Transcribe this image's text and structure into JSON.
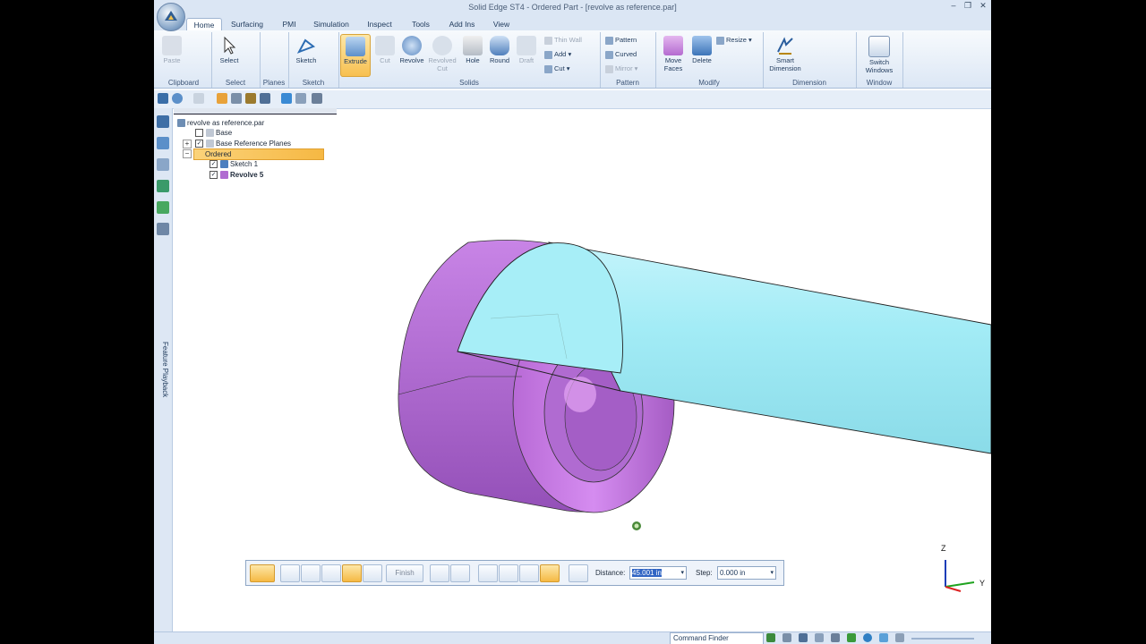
{
  "window": {
    "title": "Solid Edge ST4 - Ordered Part - [revolve as reference.par]",
    "minimize": "–",
    "restore": "❐",
    "close": "✕",
    "help": "?"
  },
  "tabs": [
    {
      "label": "Home"
    },
    {
      "label": "Surfacing"
    },
    {
      "label": "PMI"
    },
    {
      "label": "Simulation"
    },
    {
      "label": "Inspect"
    },
    {
      "label": "Tools"
    },
    {
      "label": "Add Ins"
    },
    {
      "label": "View"
    }
  ],
  "ribbon": {
    "groups": {
      "clipboard": "Clipboard",
      "select": "Select",
      "planes": "Planes",
      "sketch": "Sketch",
      "solids": "Solids",
      "pattern": "Pattern",
      "modify": "Modify",
      "dimension": "Dimension",
      "window": "Window"
    },
    "buttons": {
      "paste": "Paste",
      "select": "Select",
      "sketch": "Sketch",
      "extrude": "Extrude",
      "cut": "Cut",
      "revolve": "Revolve",
      "revolved_cut_1": "Revolved",
      "revolved_cut_2": "Cut",
      "hole": "Hole",
      "round": "Round",
      "draft": "Draft",
      "thin_wall": "Thin Wall",
      "add": "Add",
      "cut_small": "Cut",
      "pattern": "Pattern",
      "curved": "Curved",
      "mirror": "Mirror",
      "move_faces_1": "Move",
      "move_faces_2": "Faces",
      "delete": "Delete",
      "resize": "Resize",
      "smart_dim_1": "Smart",
      "smart_dim_2": "Dimension",
      "switch_1": "Switch",
      "switch_2": "Windows"
    }
  },
  "tree": {
    "root": "revolve as reference.par",
    "base": "Base",
    "ref_planes": "Base Reference Planes",
    "ordered": "Ordered",
    "sketch1": "Sketch 1",
    "revolve5": "Revolve 5"
  },
  "side_panel": {
    "feature_playback": "Feature Playback"
  },
  "command_bar": {
    "finish": "Finish",
    "distance_label": "Distance:",
    "distance_value": "45.001 in",
    "step_label": "Step:",
    "step_value": "0.000 in"
  },
  "triad": {
    "z": "Z",
    "y": "Y"
  },
  "status": {
    "command_finder": "Command Finder"
  },
  "colors": {
    "part_purple": "#c97fe0",
    "tube_cyan": "#9eeaf5",
    "accent_orange": "#f7c050",
    "ribbon_blue": "#dbe6f4"
  }
}
